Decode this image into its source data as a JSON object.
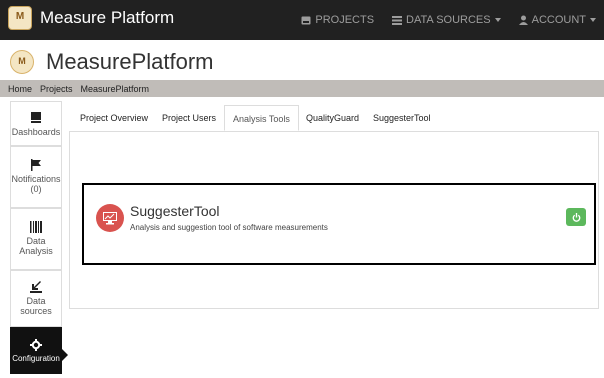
{
  "navbar": {
    "brand": "Measure Platform",
    "items": [
      {
        "label": "PROJECTS",
        "icon": "hdd-icon"
      },
      {
        "label": "DATA SOURCES",
        "icon": "list-icon"
      },
      {
        "label": "ACCOUNT",
        "icon": "user-icon"
      }
    ]
  },
  "page": {
    "title": "MeasurePlatform"
  },
  "breadcrumb": [
    "Home",
    "Projects",
    "MeasurePlatform"
  ],
  "sidebar": [
    {
      "label": "Dashboards",
      "icon": "dashboard-flag-icon"
    },
    {
      "label": "Notifications",
      "count": "(0)",
      "icon": "notification-flag-icon"
    },
    {
      "label": "Data Analysis",
      "icon": "barcode-icon"
    },
    {
      "label": "Data sources",
      "icon": "import-icon"
    },
    {
      "label": "Configuration",
      "icon": "gear-icon"
    }
  ],
  "tabs": [
    "Project Overview",
    "Project Users",
    "Analysis Tools",
    "QualityGuard",
    "SuggesterTool"
  ],
  "active_tab": "Analysis Tools",
  "tool": {
    "name": "SuggesterTool",
    "description": "Analysis and suggestion tool of software measurements"
  },
  "colors": {
    "navbar": "#212121",
    "danger": "#d9534f",
    "success": "#5cb85c"
  }
}
